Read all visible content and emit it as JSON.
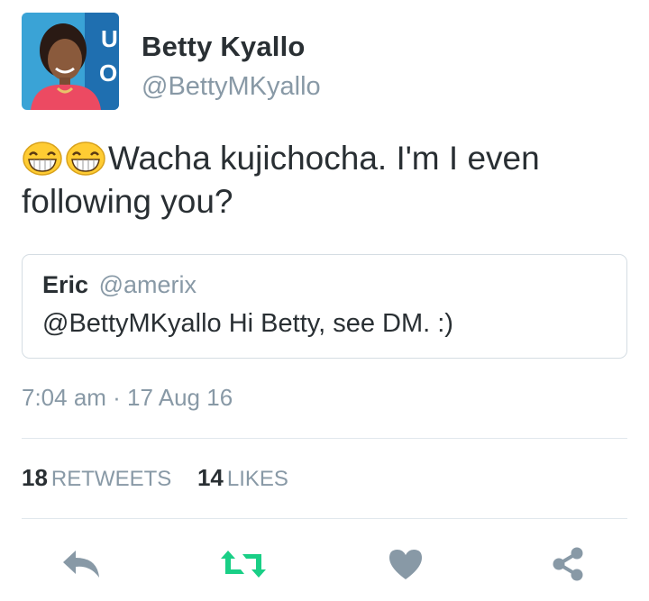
{
  "author": {
    "name": "Betty Kyallo",
    "handle": "@BettyMKyallo",
    "avatar_icon": "profile-photo"
  },
  "tweet": {
    "emojis": [
      "grinning-face-icon",
      "grinning-face-icon"
    ],
    "text": "Wacha kujichocha. I'm I even following you?"
  },
  "quoted_tweet": {
    "name": "Eric",
    "handle": "@amerix",
    "text": "@BettyMKyallo Hi Betty, see DM. :)"
  },
  "timestamp": "7:04 am · 17 Aug 16",
  "stats": {
    "retweets_count": "18",
    "retweets_label": "RETWEETS",
    "likes_count": "14",
    "likes_label": "LIKES"
  },
  "actions": {
    "reply_icon": "reply-icon",
    "retweet_icon": "retweet-icon",
    "like_icon": "heart-icon",
    "share_icon": "share-icon"
  },
  "colors": {
    "text": "#292f33",
    "muted": "#8899a6",
    "retweet_green": "#19cf86",
    "icon_gray": "#8899a6",
    "border": "#e1e8ed"
  }
}
